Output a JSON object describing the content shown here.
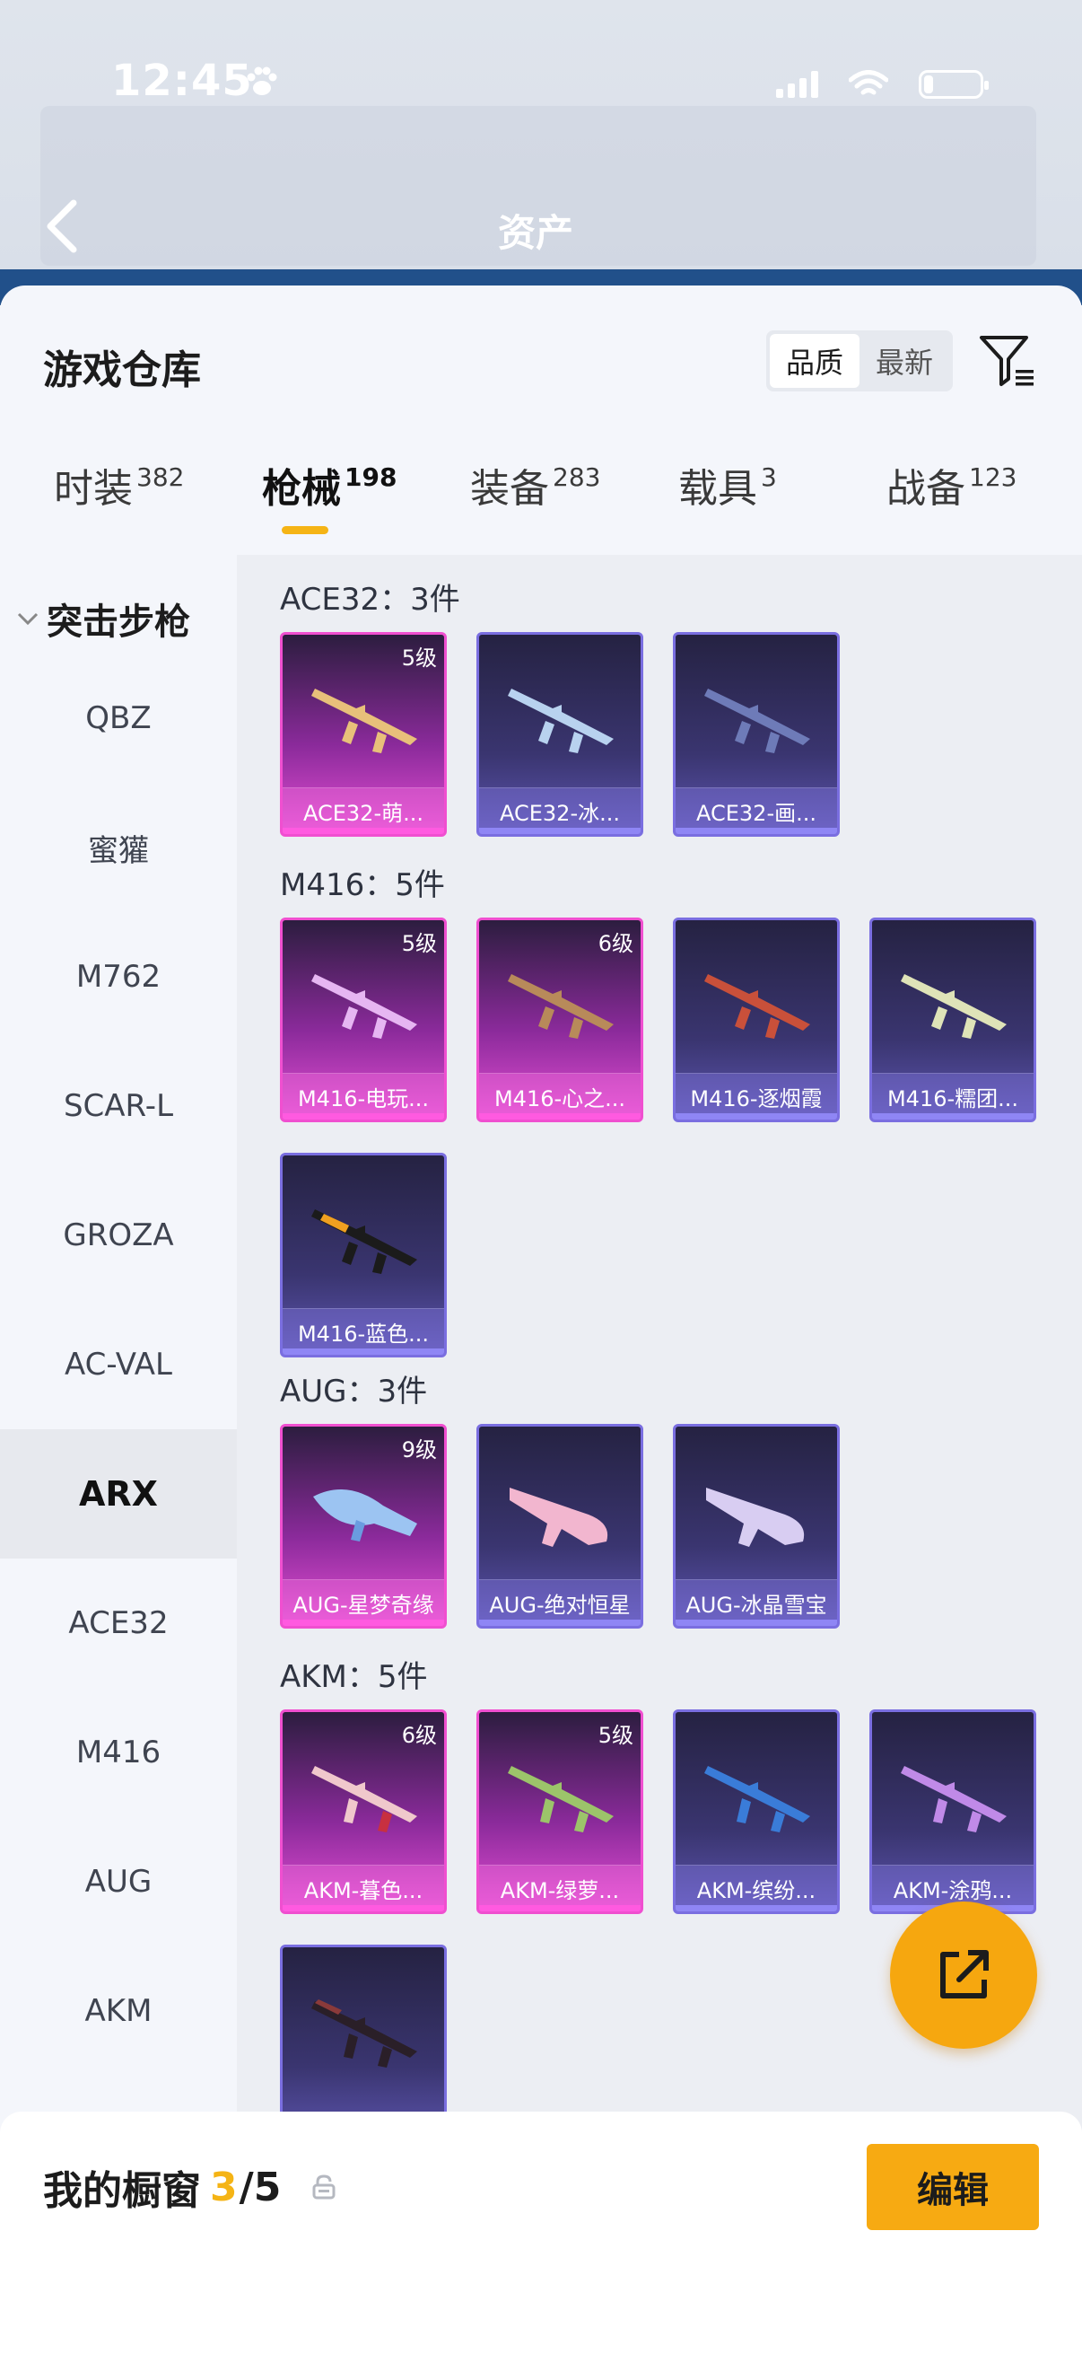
{
  "status_bar": {
    "time": "12:45",
    "paw_icon": "paw-icon"
  },
  "header": {
    "title": "资产",
    "back_icon": "back-arrow-icon"
  },
  "warehouse": {
    "title": "游戏仓库",
    "sort_options": [
      "品质",
      "最新"
    ],
    "sort_selected": "品质",
    "filter_icon": "filter-icon"
  },
  "tabs": [
    {
      "label": "时装",
      "count": "382"
    },
    {
      "label": "枪械",
      "count": "198",
      "active": true
    },
    {
      "label": "装备",
      "count": "283"
    },
    {
      "label": "载具",
      "count": "3"
    },
    {
      "label": "战备",
      "count": "123"
    }
  ],
  "sidebar": {
    "header": "突击步枪",
    "items": [
      "QBZ",
      "蜜獾",
      "M762",
      "SCAR-L",
      "GROZA",
      "AC-VAL",
      "ARX",
      "ACE32",
      "M416",
      "AUG",
      "AKM"
    ],
    "active": "ARX"
  },
  "groups": [
    {
      "title": "ACE32：3件",
      "items": [
        {
          "name": "ACE32-萌...",
          "level": "5级",
          "tier": "pink"
        },
        {
          "name": "ACE32-冰...",
          "level": "",
          "tier": "purple"
        },
        {
          "name": "ACE32-画...",
          "level": "",
          "tier": "purple"
        }
      ]
    },
    {
      "title": "M416：5件",
      "items": [
        {
          "name": "M416-电玩...",
          "level": "5级",
          "tier": "pink"
        },
        {
          "name": "M416-心之...",
          "level": "6级",
          "tier": "pink"
        },
        {
          "name": "M416-逐烟霞",
          "level": "",
          "tier": "purple"
        },
        {
          "name": "M416-糯团...",
          "level": "",
          "tier": "purple"
        },
        {
          "name": "M416-蓝色...",
          "level": "",
          "tier": "purple"
        }
      ]
    },
    {
      "title": "AUG：3件",
      "items": [
        {
          "name": "AUG-星梦奇缘",
          "level": "9级",
          "tier": "pink"
        },
        {
          "name": "AUG-绝对恒星",
          "level": "",
          "tier": "purple"
        },
        {
          "name": "AUG-冰晶雪宝",
          "level": "",
          "tier": "purple"
        }
      ]
    },
    {
      "title": "AKM：5件",
      "items": [
        {
          "name": "AKM-暮色...",
          "level": "6级",
          "tier": "pink"
        },
        {
          "name": "AKM-绿萝...",
          "level": "5级",
          "tier": "pink"
        },
        {
          "name": "AKM-缤纷...",
          "level": "",
          "tier": "purple"
        },
        {
          "name": "AKM-涂鸦...",
          "level": "",
          "tier": "purple"
        },
        {
          "name": "",
          "level": "",
          "tier": "purple"
        }
      ]
    }
  ],
  "share_icon": "share-external-icon",
  "showcase": {
    "label": "我的橱窗",
    "current": "3",
    "total": "/5",
    "lock_icon": "lock-icon"
  },
  "edit_button": "编辑",
  "colors": {
    "accent": "#f5b415",
    "pink_tier": "#f04fd0",
    "purple_tier": "#7a6ee0"
  }
}
